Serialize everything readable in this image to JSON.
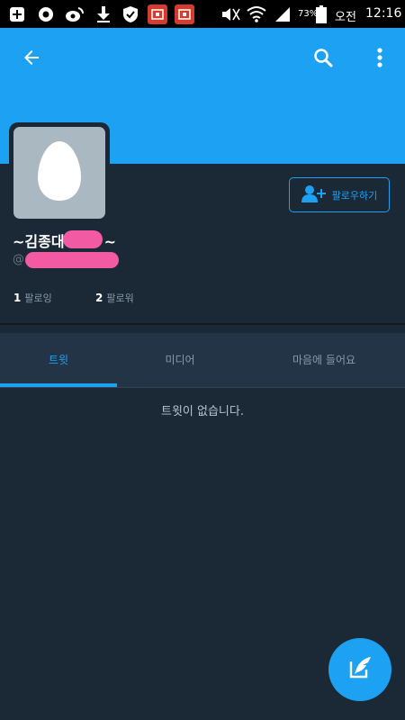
{
  "status_bar": {
    "battery": "73%",
    "time_period": "오전",
    "time": "12:16",
    "icons": [
      "add-box-icon",
      "chrome-icon",
      "weibo-icon",
      "download-icon",
      "shield-icon",
      "red-app-icon",
      "red-app-icon",
      "mute-icon",
      "wifi-icon",
      "signal-icon",
      "battery-icon"
    ]
  },
  "header": {
    "back_icon": "arrow-left-icon",
    "search_icon": "search-icon",
    "menu_icon": "more-vert-icon"
  },
  "profile": {
    "name_visible": "~김종대",
    "name_suffix": "~",
    "handle_prefix": "@",
    "follow_label": "팔로우하기",
    "following_count": "1",
    "following_label": "팔로잉",
    "followers_count": "2",
    "followers_label": "팔로워"
  },
  "tabs": [
    {
      "label": "트윗",
      "active": true
    },
    {
      "label": "미디어",
      "active": false
    },
    {
      "label": "마음에 들어요",
      "active": false
    }
  ],
  "empty_state": "트윗이 없습니다.",
  "fab": {
    "icon": "compose-quill-icon"
  },
  "colors": {
    "accent": "#1da1f2",
    "background": "#1b2836",
    "tab_bar": "#243447",
    "redaction": "#f25aa3"
  }
}
